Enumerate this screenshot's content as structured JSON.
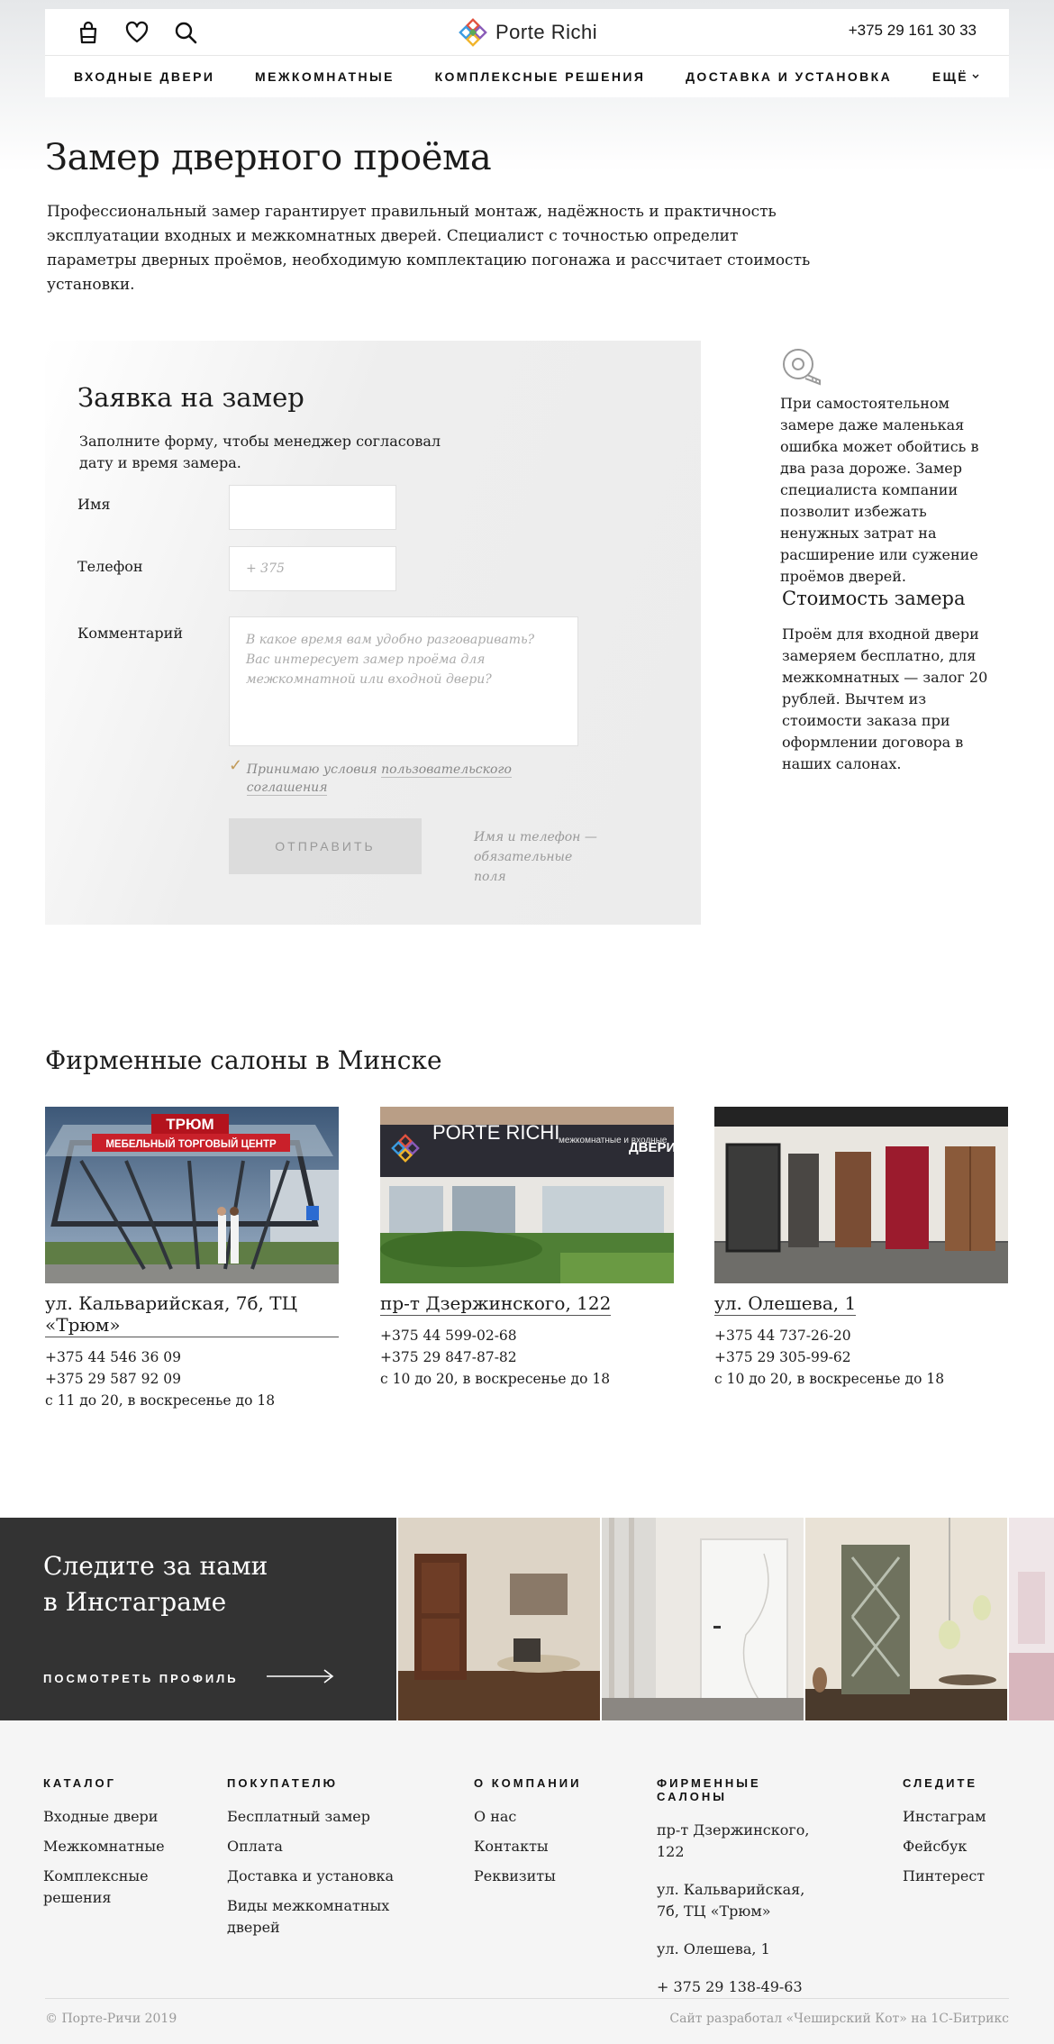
{
  "header": {
    "logo_text": "Porte Richi",
    "phone": "+375 29 161 30 33",
    "icons": [
      "bag-icon",
      "heart-icon",
      "search-icon"
    ],
    "nav": [
      "ВХОДНЫЕ ДВЕРИ",
      "МЕЖКОМНАТНЫЕ",
      "КОМПЛЕКСНЫЕ РЕШЕНИЯ",
      "ДОСТАВКА И УСТАНОВКА",
      "ЕЩЁ"
    ]
  },
  "page": {
    "title": "Замер дверного проёма",
    "intro": "Профессиональный замер гарантирует правильный монтаж, надёжность и практичность эксплуатации входных и межкомнатных дверей. Специалист с точностью определит параметры дверных проёмов, необходимую комплектацию погонажа и рассчитает стоимость установки."
  },
  "form": {
    "title": "Заявка на замер",
    "subtitle": "Заполните форму, чтобы менеджер согласовал дату и время замера.",
    "name_label": "Имя",
    "name_value": "",
    "phone_label": "Телефон",
    "phone_placeholder": "+ 375",
    "comment_label": "Комментарий",
    "comment_placeholder": "В какое время вам удобно разговаривать? Вас интересует замер проёма для межкомнатной или входной двери?",
    "agree_prefix": "Принимаю условия ",
    "agree_link": "пользовательского соглашения",
    "agree_checked": true,
    "submit": "ОТПРАВИТЬ",
    "required_note": "Имя и телефон — обязательные поля"
  },
  "sidebar": {
    "icon": "tape-measure-icon",
    "note": "При самостоятельном замере даже маленькая ошибка может обойтись в два раза дороже. Замер специалиста компании позволит избежать ненужных затрат на расширение или сужение проёмов дверей.",
    "price_title": "Стоимость замера",
    "price_text": "Проём для входной двери замеряем бесплатно, для межкомнатных — залог 20 рублей. Вычтем из стоимости заказа при оформлении договора в наших салонах."
  },
  "salons": {
    "title": "Фирменные салоны в Минске",
    "items": [
      {
        "address": "ул. Кальварийская, 7б, ТЦ «Трюм»",
        "phone1": "+375 44 546 36 09",
        "phone2": "+375 29 587 92 09",
        "hours": "с 11 до 20, в воскресенье до 18",
        "photo_sign": "ТРЮМ",
        "photo_banner": "МЕБЕЛЬНЫЙ ТОРГОВЫЙ ЦЕНТР"
      },
      {
        "address": "пр-т Дзержинского, 122",
        "phone1": "+375 44 599-02-68",
        "phone2": "+375 29 847-87-82",
        "hours": "с 10 до 20, в воскресенье до 18",
        "photo_sign": "PORTE RICHI",
        "photo_sub": "межкомнатные и входные",
        "photo_doors": "ДВЕРИ"
      },
      {
        "address": "ул. Олешева, 1",
        "phone1": "+375 44 737-26-20",
        "phone2": "+375 29 305-99-62",
        "hours": "с 10 до 20, в воскресенье до 18"
      }
    ]
  },
  "instagram": {
    "title_line1": "Следите за нами",
    "title_line2": "в Инстаграме",
    "link": "ПОСМОТРЕТЬ ПРОФИЛЬ"
  },
  "footer": {
    "columns": [
      {
        "title": "КАТАЛОГ",
        "items": [
          "Входные двери",
          "Межкомнатные",
          "Комплексные решения"
        ]
      },
      {
        "title": "ПОКУПАТЕЛЮ",
        "items": [
          "Бесплатный замер",
          "Оплата",
          "Доставка и установка",
          "Виды межкомнатных дверей"
        ]
      },
      {
        "title": "О КОМПАНИИ",
        "items": [
          "О нас",
          "Контакты",
          "Реквизиты"
        ]
      },
      {
        "title": "ФИРМЕННЫЕ САЛОНЫ",
        "items": [
          "пр-т Дзержинского, 122",
          "ул. Кальварийская, 7б, ТЦ «Трюм»",
          "ул. Олешева, 1",
          "+ 375 29 138-49-63"
        ]
      },
      {
        "title": "СЛЕДИТЕ",
        "items": [
          "Инстаграм",
          "Фейсбук",
          "Пинтерест"
        ]
      }
    ],
    "copyright": "© Порте-Ричи 2019",
    "developer": "Сайт разработал «Чеширский Кот» на 1С-Битрикс"
  }
}
